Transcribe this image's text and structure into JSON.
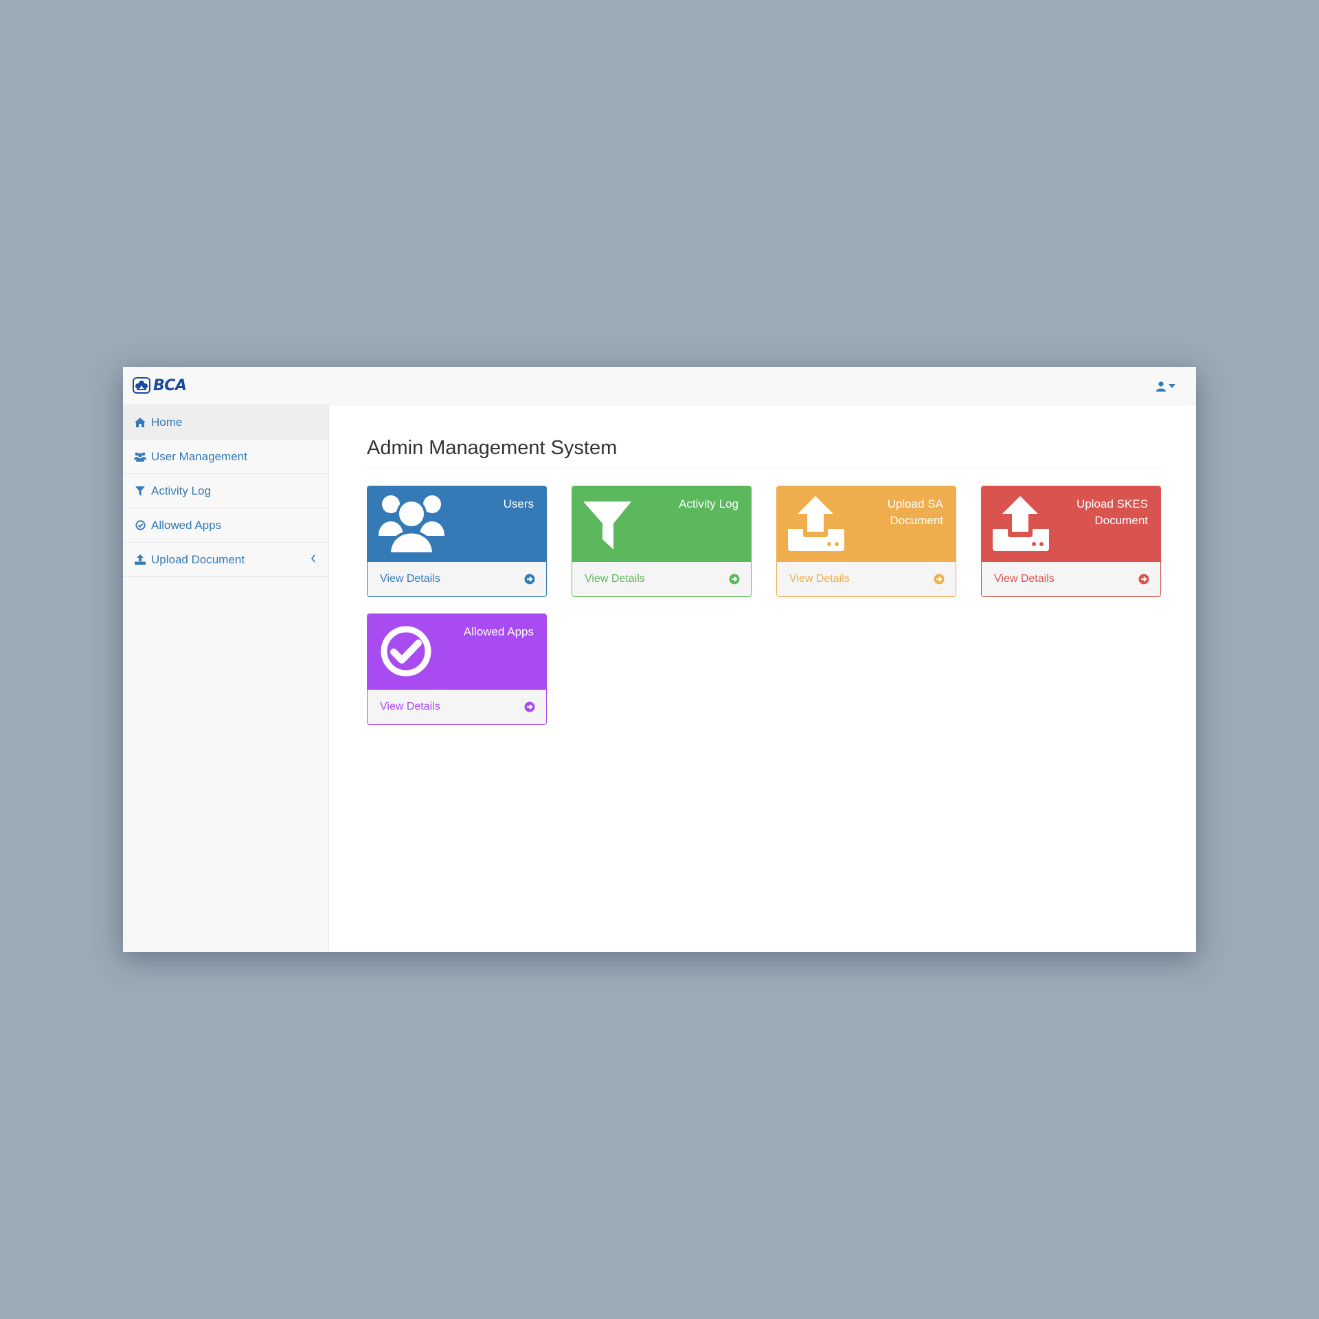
{
  "brand": {
    "name": "BCA",
    "color": "#1a4b9c"
  },
  "topbar": {
    "user_icon": "user-icon",
    "caret_icon": "caret-down-icon"
  },
  "sidebar": {
    "items": [
      {
        "label": "Home",
        "icon": "home-icon",
        "active": true
      },
      {
        "label": "User Management",
        "icon": "users-icon"
      },
      {
        "label": "Activity Log",
        "icon": "filter-icon"
      },
      {
        "label": "Allowed Apps",
        "icon": "check-circle-icon"
      },
      {
        "label": "Upload Document",
        "icon": "upload-icon",
        "expand_icon": "chevron-left-icon"
      }
    ]
  },
  "main": {
    "title": "Admin Management System",
    "cards": [
      {
        "label": "Users",
        "icon": "users-icon",
        "footer": "View Details",
        "color": "#337ab7"
      },
      {
        "label": "Activity Log",
        "icon": "filter-icon",
        "footer": "View Details",
        "color": "#5cb85c"
      },
      {
        "label": "Upload SA Document",
        "icon": "upload-icon",
        "footer": "View Details",
        "color": "#f0ad4e"
      },
      {
        "label": "Upload SKES Document",
        "icon": "upload-icon",
        "footer": "View Details",
        "color": "#d9534f"
      },
      {
        "label": "Allowed Apps",
        "icon": "check-circle-icon",
        "footer": "View Details",
        "color": "#a84bf0"
      }
    ]
  }
}
